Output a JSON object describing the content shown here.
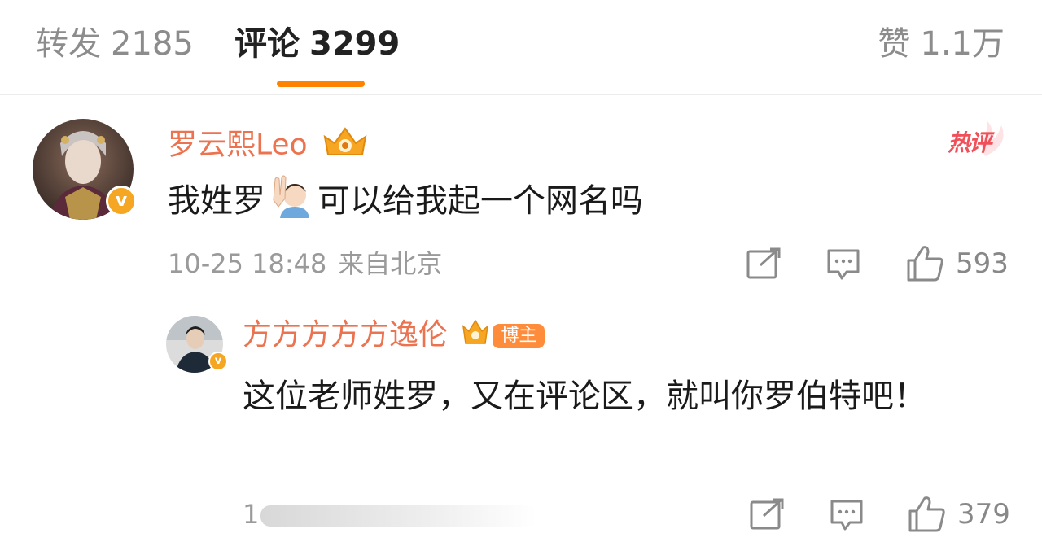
{
  "tabs": {
    "forward": {
      "label": "转发",
      "count": "2185"
    },
    "comments": {
      "label": "评论",
      "count": "3299"
    },
    "likes": {
      "label": "赞",
      "count": "1.1万"
    }
  },
  "comment": {
    "username": "罗云熙Leo",
    "hot_label": "热评",
    "text_before_emoji": "我姓罗",
    "text_after_emoji": "可以给我起一个网名吗",
    "date": "10-25 18:48",
    "location": "来自北京",
    "like_count": "593"
  },
  "reply": {
    "username": "方方方方方逸伦",
    "badge_label": "博主",
    "text": "这位老师姓罗，又在评论区，就叫你罗伯特吧！",
    "time_prefix": "1",
    "like_count": "379"
  },
  "colors": {
    "accent": "#ff8200",
    "username": "#eb7350",
    "hot": "#f0505a",
    "muted": "#9a9a9a"
  },
  "icons": [
    "crown-badge-icon",
    "verified-v-icon",
    "raised-hand-emoji-icon",
    "repost-icon",
    "comment-icon",
    "like-thumb-icon"
  ]
}
